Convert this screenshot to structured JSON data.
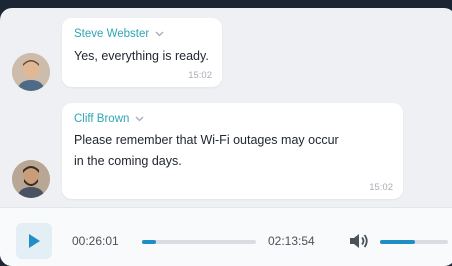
{
  "messages": [
    {
      "sender": "Steve Webster",
      "text": "Yes, everything is ready.",
      "time": "15:02",
      "avatar_icon": "person-avatar"
    },
    {
      "sender": "Cliff Brown",
      "text": "Please remember that Wi-Fi outages may occur\nin the coming days.",
      "time": "15:02",
      "avatar_icon": "person-avatar"
    }
  ],
  "player": {
    "elapsed": "00:26:01",
    "remaining": "02:13:54",
    "progress_fraction": 0.12,
    "volume_fraction": 0.52,
    "play_icon": "play-icon",
    "volume_icon": "volume-icon"
  },
  "colors": {
    "accent": "#1e8ec4",
    "sender_name": "#2ea6b4",
    "background_dark": "#1c2533",
    "panel": "#eef0f3"
  }
}
